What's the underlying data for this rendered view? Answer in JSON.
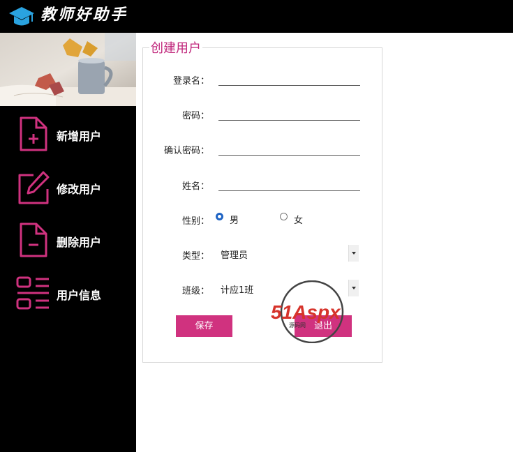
{
  "header": {
    "app_title": "教师好助手"
  },
  "sidebar": {
    "items": [
      {
        "label": "新增用户",
        "icon": "file-plus-icon"
      },
      {
        "label": "修改用户",
        "icon": "edit-icon"
      },
      {
        "label": "删除用户",
        "icon": "file-minus-icon"
      },
      {
        "label": "用户信息",
        "icon": "list-icon"
      }
    ]
  },
  "form": {
    "legend": "创建用户",
    "login_label": "登录名：",
    "password_label": "密码：",
    "confirm_label": "确认密码：",
    "name_label": "姓名：",
    "gender_label": "性别：",
    "gender_male": "男",
    "gender_female": "女",
    "gender_selected": "男",
    "type_label": "类型：",
    "type_value": "管理员",
    "class_label": "班级：",
    "class_value": "计应1班",
    "save_label": "保存",
    "exit_label": "退出"
  },
  "watermark": {
    "text": "51Aspx",
    "sub": "源码网"
  },
  "colors": {
    "accent": "#c0267b",
    "button": "#d0327f",
    "sidebar": "#000000"
  }
}
